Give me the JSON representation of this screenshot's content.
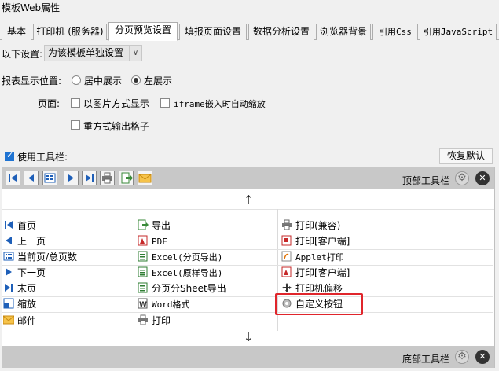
{
  "window": {
    "title": "模板Web属性"
  },
  "tabs": [
    {
      "label": "基本"
    },
    {
      "label": "打印机 (服务器)"
    },
    {
      "label": "分页预览设置"
    },
    {
      "label": "填报页面设置"
    },
    {
      "label": "数据分析设置"
    },
    {
      "label": "浏览器背景"
    },
    {
      "label": "引用Css"
    },
    {
      "label": "引用JavaScript"
    }
  ],
  "settings": {
    "scope_label": "以下设置:",
    "scope_value": "为该模板单独设置",
    "position_label": "报表显示位置:",
    "position_options": [
      "居中展示",
      "左展示"
    ],
    "page_label": "页面:",
    "page_options": [
      "以图片方式显示",
      "iframe嵌入时自动缩放",
      "重方式输出格子"
    ],
    "use_toolbar_label": "使用工具栏:",
    "restore_default": "恢复默认"
  },
  "toolbar_panel": {
    "top_label": "顶部工具栏",
    "bottom_label": "底部工具栏",
    "up_arrow": "↑",
    "down_arrow": "↓"
  },
  "buttons": {
    "col1": [
      "首页",
      "上一页",
      "当前页/总页数",
      "下一页",
      "末页",
      "缩放",
      "邮件"
    ],
    "col2": [
      "导出",
      "PDF",
      "Excel(分页导出)",
      "Excel(原样导出)",
      "分页分Sheet导出",
      "Word格式",
      "打印"
    ],
    "col3": [
      "打印(兼容)",
      "打印[客户端]",
      "Applet打印",
      "打印[客户端]",
      "打印机偏移",
      "自定义按钮"
    ]
  },
  "colors": {
    "highlight": "#e0252b",
    "accent": "#1e73d2",
    "strip": "#c8c8c8"
  }
}
